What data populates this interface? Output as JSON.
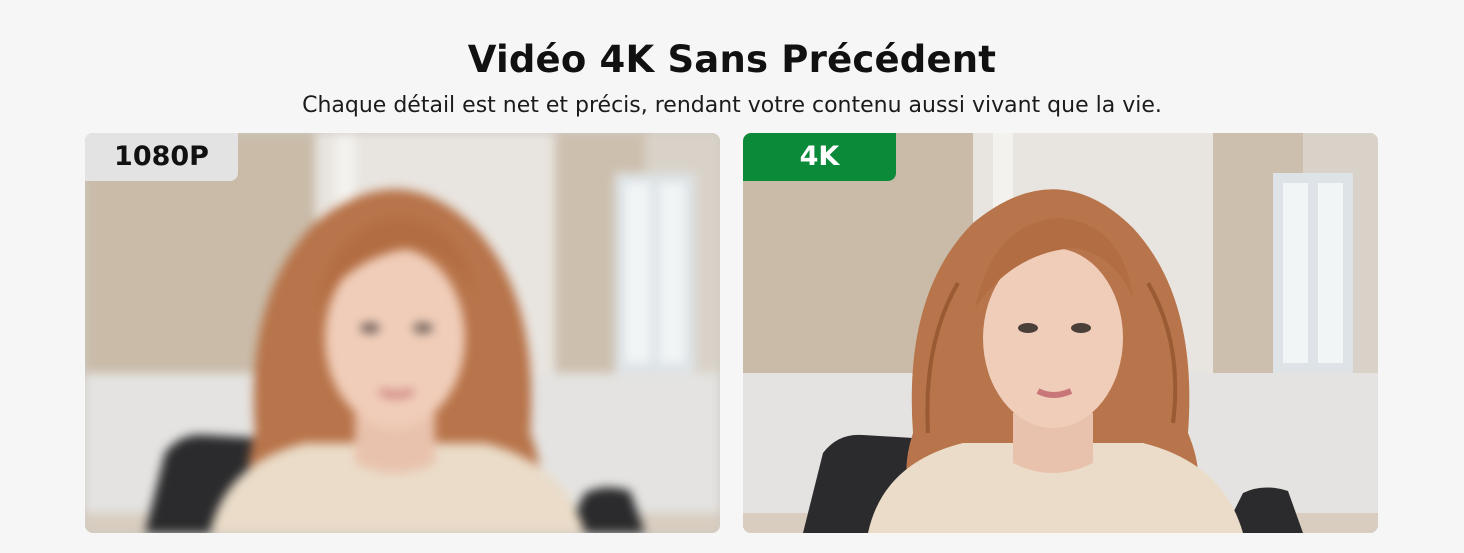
{
  "header": {
    "title": "Vidéo 4K Sans Précédent",
    "subtitle": "Chaque détail est net et précis, rendant votre contenu aussi vivant que la vie."
  },
  "comparison": {
    "left": {
      "badge": "1080P",
      "badge_bg": "#e3e3e3",
      "badge_color": "#111111"
    },
    "right": {
      "badge": "4K",
      "badge_bg": "#0b8a3a",
      "badge_color": "#ffffff"
    }
  }
}
